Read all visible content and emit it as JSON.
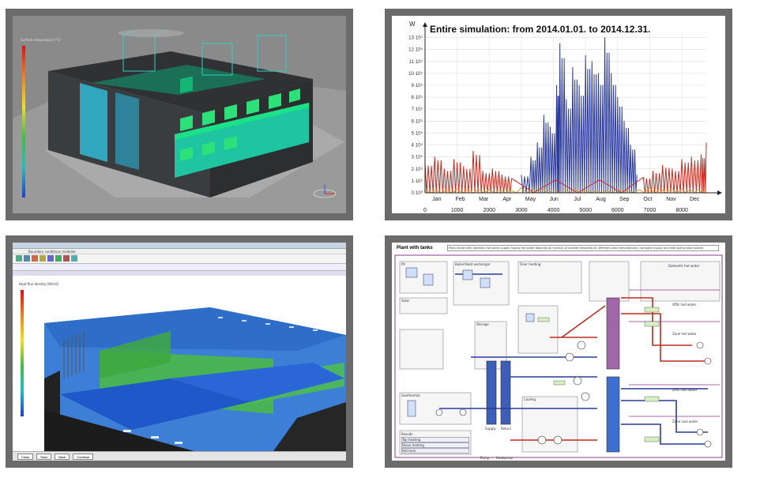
{
  "panel1": {
    "legend_title": "Surface temperature [°C]"
  },
  "panel2": {
    "title": "Entire simulation: from 2014.01.01. to 2014.12.31.",
    "y_unit": "W",
    "chart_data": {
      "type": "line",
      "title": "Entire simulation: from 2014.01.01. to 2014.12.31.",
      "ylabel": "W",
      "x_ticks": [
        0,
        1000,
        2000,
        3000,
        4000,
        5000,
        6000,
        7000,
        8000
      ],
      "y_ticks": [
        "0·10⁰",
        "1·10⁵",
        "2·10⁵",
        "3·10⁵",
        "4·10⁵",
        "5·10⁵",
        "6·10⁵",
        "7·10⁵",
        "8·10⁵",
        "9·10⁵",
        "10·10⁵",
        "11·10⁵",
        "12·10⁵",
        "13·10⁵"
      ],
      "months": [
        "Jan",
        "Feb",
        "Mar",
        "Apr",
        "May",
        "Jun",
        "Jul",
        "Aug",
        "Sep",
        "Oct",
        "Nov",
        "Dec"
      ],
      "xlim": [
        0,
        8760
      ],
      "ylim": [
        0,
        1350000
      ],
      "series": [
        {
          "color": "#2b3a9e",
          "x": [
            3000,
            3300,
            3500,
            3700,
            3900,
            4100,
            4200,
            4400,
            4600,
            4800,
            5000,
            5200,
            5400,
            5600,
            5800,
            6000,
            6200,
            6400,
            6600
          ],
          "y": [
            150000,
            300000,
            420000,
            650000,
            550000,
            900000,
            1250000,
            780000,
            1050000,
            900000,
            1150000,
            1100000,
            1000000,
            1300000,
            1000000,
            800000,
            600000,
            400000,
            150000
          ]
        },
        {
          "color": "#cc2a1e",
          "x": [
            0,
            300,
            600,
            900,
            1200,
            1500,
            1800,
            2100,
            2400,
            2700,
            6800,
            7100,
            7400,
            7700,
            8000,
            8300,
            8600,
            8760
          ],
          "y": [
            250000,
            300000,
            200000,
            280000,
            220000,
            350000,
            180000,
            200000,
            150000,
            120000,
            130000,
            180000,
            230000,
            200000,
            280000,
            300000,
            320000,
            420000
          ]
        },
        {
          "color": "#e0a020",
          "x": [
            0,
            1000,
            2000,
            3000,
            4000,
            5000,
            6000,
            7000,
            8000,
            8760
          ],
          "y": [
            20000,
            30000,
            25000,
            40000,
            30000,
            20000,
            30000,
            40000,
            30000,
            30000
          ]
        }
      ]
    }
  },
  "panel3": {
    "window_title": "Boundary conditions modeller",
    "legend_title": "Heat flux density [W/m2]",
    "buttons": [
      "Close",
      "Save",
      "Back",
      "Continue"
    ]
  },
  "panel4": {
    "title": "Plant with tanks",
    "description": "Plant model with domestic hot water supply. Supply hot water depends on function of outside temperature. Different zone temperatures, hot water supply and heat pump solar system.",
    "labels": {
      "pv": "PV",
      "boiler": "Boiler/Heat exchanger",
      "floor_heating": "Floor heating",
      "solar": "Solar",
      "geo": "Geothermal",
      "storage": "Storage",
      "supply": "Supply",
      "return": "Return",
      "cooling": "Cooling",
      "results": "Results",
      "pump": "Pump",
      "heatpump": "Heatpump"
    },
    "results_items": [
      "Top heating",
      "Stove heating",
      "Hot tank"
    ],
    "right_labels": [
      "Domestic hot water",
      "Offic hall water",
      "Zone hot water",
      "Offic cool water",
      "Zone cool water"
    ]
  }
}
